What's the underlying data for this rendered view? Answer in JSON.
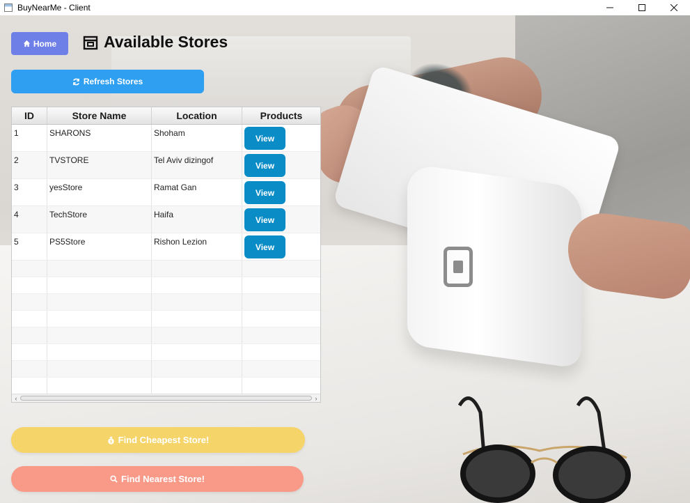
{
  "window": {
    "title": "BuyNearMe - Client",
    "controls": [
      "minimize-icon",
      "maximize-icon",
      "close-icon"
    ]
  },
  "header": {
    "home_label": "Home",
    "home_icon": "house-icon",
    "title": "Available Stores",
    "title_icon": "store-icon"
  },
  "refresh": {
    "label": "Refresh Stores",
    "icon": "refresh-icon"
  },
  "table": {
    "columns": [
      "ID",
      "Store Name",
      "Location",
      "Products"
    ],
    "rows": [
      {
        "id": "1",
        "name": "SHARONS",
        "location": "Shoham",
        "action": "View"
      },
      {
        "id": "2",
        "name": "TVSTORE",
        "location": "Tel Aviv dizingof",
        "action": "View"
      },
      {
        "id": "3",
        "name": "yesStore",
        "location": "Ramat Gan",
        "action": "View"
      },
      {
        "id": "4",
        "name": "TechStore",
        "location": "Haifa",
        "action": "View"
      },
      {
        "id": "5",
        "name": "PS5Store",
        "location": "Rishon Lezion",
        "action": "View"
      }
    ]
  },
  "actions": {
    "cheapest": {
      "label": "Find Cheapest Store!",
      "icon": "money-bag-icon"
    },
    "nearest": {
      "label": "Find Nearest Store!",
      "icon": "magnifier-icon"
    }
  },
  "colors": {
    "home": "#6f7fe8",
    "refresh": "#2f9ff1",
    "view": "#0a8cc7",
    "cheapest": "#f5d46a",
    "nearest": "#f99a89"
  }
}
